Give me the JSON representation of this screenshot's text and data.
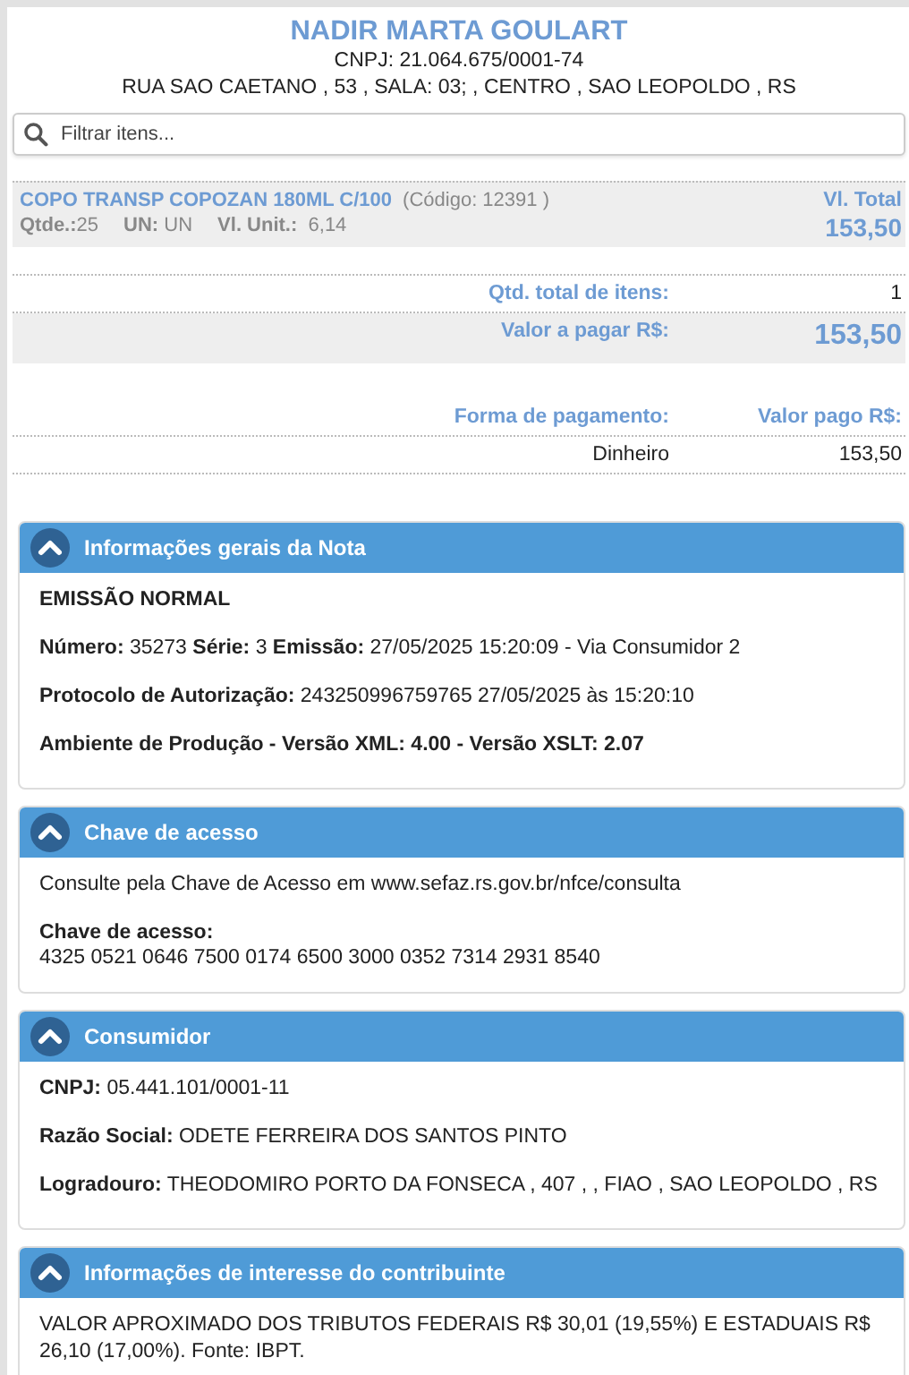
{
  "header": {
    "name": "NADIR MARTA GOULART",
    "cnpj": "CNPJ: 21.064.675/0001-74",
    "address": "RUA SAO CAETANO , 53 , SALA: 03; , CENTRO , SAO LEOPOLDO , RS"
  },
  "search": {
    "placeholder": "Filtrar itens..."
  },
  "items": [
    {
      "name": "COPO TRANSP COPOZAN 180ML C/100",
      "code": "(Código: 12391 )",
      "qty_label": "Qtde.:",
      "qty": "25",
      "unit_label": "UN:",
      "unit": "UN",
      "unit_price_label": "Vl. Unit.:",
      "unit_price": "6,14",
      "total_label": "Vl. Total",
      "total": "153,50"
    }
  ],
  "totals": [
    {
      "label": "Qtd. total de itens:",
      "value": "1",
      "highlight": false
    },
    {
      "label": "Valor a pagar R$:",
      "value": "153,50",
      "highlight": true
    }
  ],
  "payment": {
    "method_header": "Forma de pagamento:",
    "amount_header": "Valor pago R$:",
    "rows": [
      {
        "method": "Dinheiro",
        "amount": "153,50"
      }
    ]
  },
  "panels": [
    {
      "title": "Informações gerais da Nota",
      "expanded": true,
      "items": [
        {
          "kind": "text",
          "text": "**EMISSÃO NORMAL**"
        },
        {
          "kind": "text",
          "text": "**Número:** 35273 **Série:** 3 **Emissão:** 27/05/2025 15:20:09 - Via Consumidor 2"
        },
        {
          "kind": "text",
          "text": "**Protocolo de Autorização:** 243250996759765 27/05/2025 às 15:20:10"
        },
        {
          "kind": "text",
          "text": "**Ambiente de Produção - Versão XML: 4.00 - Versão XSLT: 2.07**"
        }
      ]
    },
    {
      "title": "Chave de acesso",
      "expanded": true,
      "items": [
        {
          "kind": "text",
          "text": "Consulte pela Chave de Acesso em www.sefaz.rs.gov.br/nfce/consulta"
        },
        {
          "kind": "stacked",
          "label": "Chave de acesso:",
          "value": "4325 0521 0646 7500 0174 6500 3000 0352 7314 2931 8540"
        }
      ]
    },
    {
      "title": "Consumidor",
      "expanded": true,
      "items": [
        {
          "kind": "text",
          "text": "**CNPJ:** 05.441.101/0001-11"
        },
        {
          "kind": "text",
          "text": "**Razão Social:** ODETE FERREIRA DOS SANTOS PINTO"
        },
        {
          "kind": "text",
          "text": "**Logradouro:** THEODOMIRO PORTO DA FONSECA , 407 , , FIAO , SAO LEOPOLDO , RS"
        }
      ]
    },
    {
      "title": "Informações de interesse do contribuinte",
      "expanded": true,
      "items": [
        {
          "kind": "text",
          "text": "VALOR APROXIMADO DOS TRIBUTOS FEDERAIS R$ 30,01 (19,55%) E ESTADUAIS R$ 26,10 (17,00%). Fonte: IBPT."
        }
      ]
    }
  ]
}
